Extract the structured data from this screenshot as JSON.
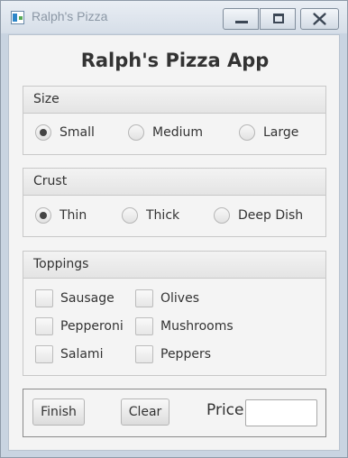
{
  "window": {
    "title": "Ralph's Pizza",
    "controls": [
      "minimize",
      "maximize",
      "close"
    ]
  },
  "app": {
    "title": "Ralph's Pizza App"
  },
  "size": {
    "label": "Size",
    "options": [
      {
        "label": "Small",
        "selected": true
      },
      {
        "label": "Medium",
        "selected": false
      },
      {
        "label": "Large",
        "selected": false
      }
    ]
  },
  "crust": {
    "label": "Crust",
    "options": [
      {
        "label": "Thin",
        "selected": true
      },
      {
        "label": "Thick",
        "selected": false
      },
      {
        "label": "Deep Dish",
        "selected": false
      }
    ]
  },
  "toppings": {
    "label": "Toppings",
    "items": [
      {
        "label": "Sausage",
        "checked": false
      },
      {
        "label": "Olives",
        "checked": false
      },
      {
        "label": "Pepperoni",
        "checked": false
      },
      {
        "label": "Mushrooms",
        "checked": false
      },
      {
        "label": "Salami",
        "checked": false
      },
      {
        "label": "Peppers",
        "checked": false
      }
    ]
  },
  "actions": {
    "finish_label": "Finish",
    "clear_label": "Clear",
    "price_label": "Price",
    "price_value": ""
  }
}
